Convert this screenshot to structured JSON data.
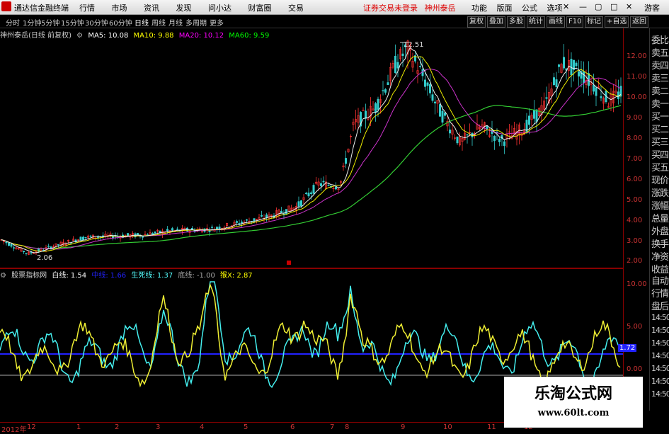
{
  "menubar": {
    "app_title": "通达信金融终端",
    "menus": [
      "行情",
      "市场",
      "资讯",
      "发现",
      "问小达",
      "财富圈",
      "交易"
    ],
    "notice": "证券交易未登录",
    "stock_title": "神州泰岳",
    "right_menus": [
      "功能",
      "版面",
      "公式",
      "选项"
    ],
    "guest": "游客"
  },
  "periods": [
    "分时",
    "1分钟",
    "5分钟",
    "15分钟",
    "30分钟",
    "60分钟",
    "日线",
    "周线",
    "月线",
    "多周期",
    "更多"
  ],
  "active_period": "日线",
  "right_buttons": [
    "复权",
    "叠加",
    "多股",
    "统计",
    "画线",
    "F10",
    "标记",
    "+自选",
    "返回"
  ],
  "info": {
    "stock": "神州泰岳(日线 前复权)",
    "ma5": "MA5: 10.08",
    "ma10": "MA10: 9.88",
    "ma20": "MA20: 10.12",
    "ma60": "MA60: 9.59",
    "colors": {
      "ma5": "#ffffff",
      "ma10": "#ffff00",
      "ma20": "#ff00ff",
      "ma60": "#00ff00"
    }
  },
  "price_axis": [
    "12.00",
    "11.00",
    "10.00",
    "9.00",
    "8.00",
    "7.00",
    "6.00",
    "5.00",
    "4.00",
    "3.00",
    "2.00"
  ],
  "annotations": {
    "high": "12.51",
    "low": "2.06"
  },
  "indicator": {
    "name": "股票指标网",
    "white": "白线: 1.54",
    "mid": "中线: 1.66",
    "life": "生死线: 1.37",
    "bottom": "底线: -1.00",
    "cross": "猴X: 2.87"
  },
  "indicator_axis": [
    "10.00",
    "5.00",
    "0.00"
  ],
  "indicator_value_box": "1.72",
  "right_panel": [
    "委比",
    "卖五",
    "卖四",
    "卖三",
    "卖二",
    "卖一",
    "买一",
    "买二",
    "买三",
    "买四",
    "买五",
    "现价",
    "涨跌",
    "涨幅",
    "总量",
    "外盘",
    "换手",
    "净资",
    "收益",
    "自动",
    "行情",
    "盘后"
  ],
  "right_times": [
    "14:50",
    "14:50",
    "14:50",
    "14:50",
    "14:50",
    "14:50",
    "14:50"
  ],
  "x_axis": [
    {
      "label": "2012年"
    },
    {
      "label": "12"
    },
    {
      "label": "1"
    },
    {
      "label": "2"
    },
    {
      "label": "3"
    },
    {
      "label": "4"
    },
    {
      "label": "5"
    },
    {
      "label": "6"
    },
    {
      "label": "7"
    },
    {
      "label": "8"
    },
    {
      "label": "9"
    },
    {
      "label": "10"
    },
    {
      "label": "11"
    },
    {
      "label": "12"
    }
  ],
  "watermark": {
    "line1": "乐淘公式网",
    "line2": "www.60lt.com"
  }
}
